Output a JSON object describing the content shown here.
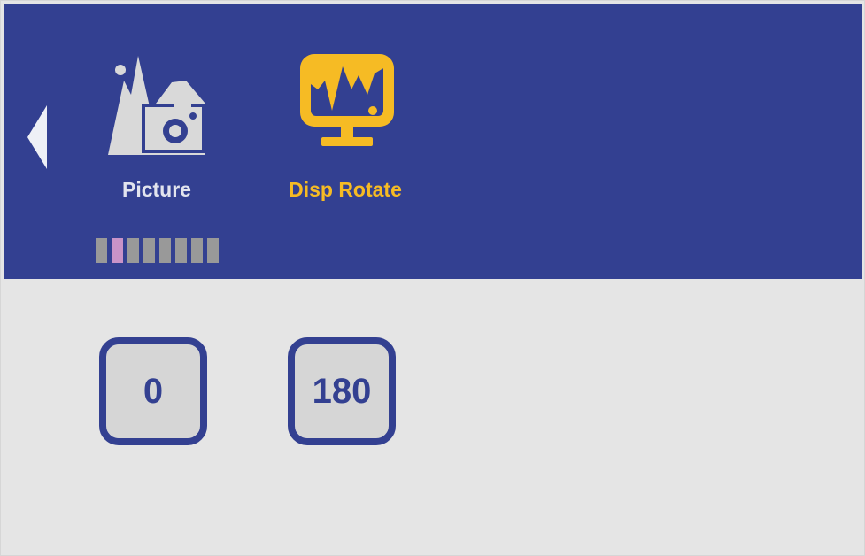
{
  "menu": {
    "items": [
      {
        "label": "Picture",
        "icon": "picture-icon",
        "selected": false
      },
      {
        "label": "Disp Rotate",
        "icon": "monitor-rotate-icon",
        "selected": true
      }
    ],
    "page_indicator": {
      "total": 8,
      "active_index": 1
    }
  },
  "options": [
    {
      "label": "0"
    },
    {
      "label": "180"
    }
  ],
  "colors": {
    "top_bar": "#334091",
    "content_bg": "#e5e5e5",
    "selected": "#f6bb24",
    "unselected": "#e2e4ee",
    "indicator": "#999999",
    "indicator_active": "#c993c8"
  }
}
